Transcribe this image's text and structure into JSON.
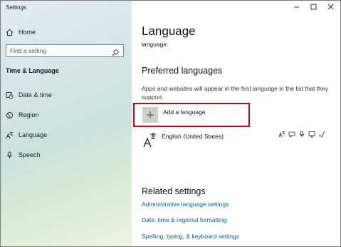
{
  "window": {
    "title": "Settings",
    "controls": {
      "minimize": "minimize-icon",
      "maximize": "maximize-icon",
      "close": "close-icon"
    }
  },
  "sidebar": {
    "home_label": "Home",
    "search_placeholder": "Find a setting",
    "section_title": "Time & Language",
    "items": [
      {
        "label": "Date & time",
        "icon": "calendar-clock-icon"
      },
      {
        "label": "Region",
        "icon": "globe-icon"
      },
      {
        "label": "Language",
        "icon": "language-icon"
      },
      {
        "label": "Speech",
        "icon": "microphone-icon"
      }
    ]
  },
  "main": {
    "title": "Language",
    "subtext": "language.",
    "preferred": {
      "heading": "Preferred languages",
      "description": "Apps and websites will appear in the first language in the list that they support.",
      "add_label": "Add a language",
      "languages": [
        {
          "name": "English (United States)",
          "features": [
            "language-pack-icon",
            "speech-icon",
            "text-to-speech-icon",
            "handwriting-icon",
            "display-icon"
          ]
        }
      ]
    },
    "related": {
      "heading": "Related settings",
      "links": [
        "Administrative language settings",
        "Date, time & regional formatting",
        "Spelling, typing, & keyboard settings"
      ]
    }
  },
  "colors": {
    "accent_link": "#0063b1",
    "highlight_border": "#d0021b"
  }
}
